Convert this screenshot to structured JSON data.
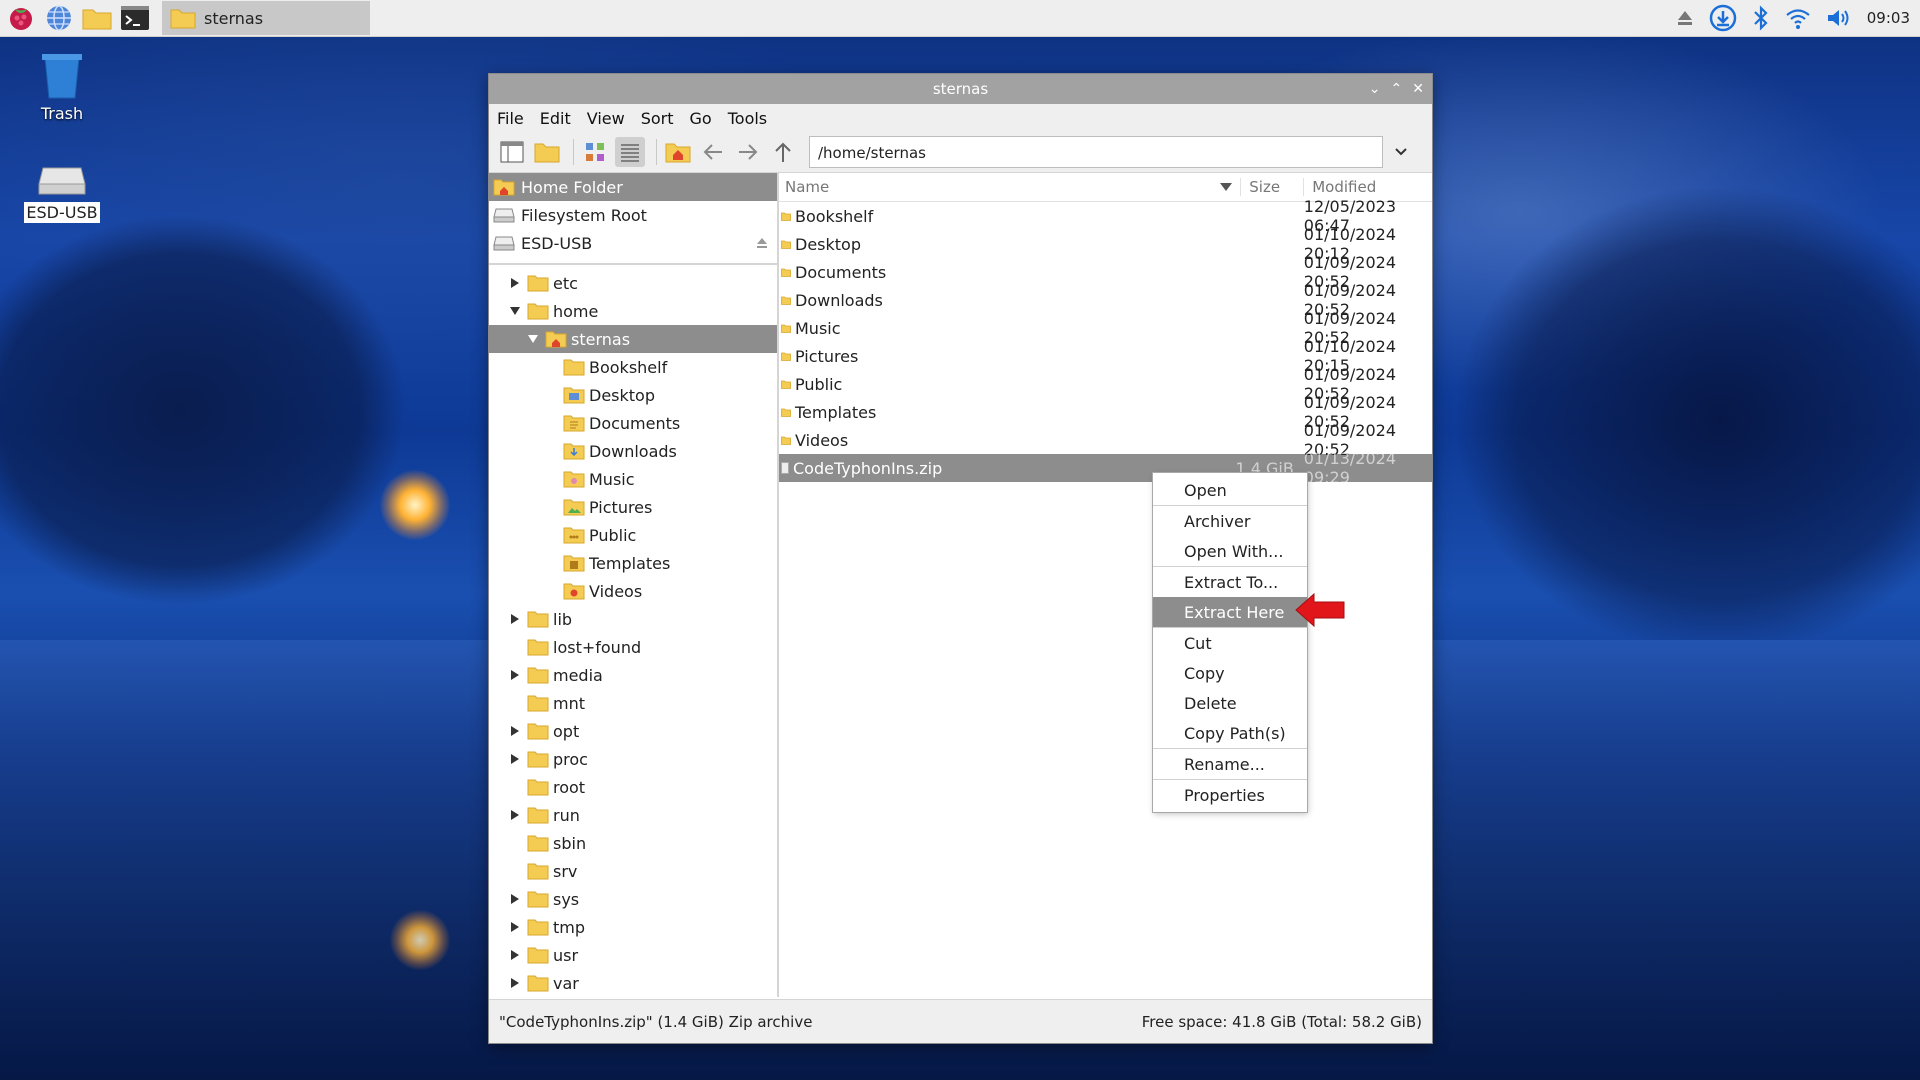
{
  "taskbar": {
    "task_label": "sternas",
    "clock": "09:03"
  },
  "desktop": {
    "icons": [
      {
        "label": "Trash"
      },
      {
        "label": "ESD-USB"
      }
    ]
  },
  "window": {
    "title": "sternas",
    "menu": [
      "File",
      "Edit",
      "View",
      "Sort",
      "Go",
      "Tools"
    ],
    "path": "/home/sternas"
  },
  "places": [
    {
      "label": "Home Folder",
      "icon": "home-icon",
      "selected": true
    },
    {
      "label": "Filesystem Root",
      "icon": "drive-icon"
    },
    {
      "label": "ESD-USB",
      "icon": "drive-icon",
      "eject": true
    }
  ],
  "tree": [
    {
      "label": "etc",
      "depth": 0,
      "exp": "collapsed"
    },
    {
      "label": "home",
      "depth": 0,
      "exp": "expanded"
    },
    {
      "label": "sternas",
      "depth": 1,
      "exp": "expanded",
      "home": true,
      "selected": true
    },
    {
      "label": "Bookshelf",
      "depth": 2
    },
    {
      "label": "Desktop",
      "depth": 2
    },
    {
      "label": "Documents",
      "depth": 2
    },
    {
      "label": "Downloads",
      "depth": 2
    },
    {
      "label": "Music",
      "depth": 2
    },
    {
      "label": "Pictures",
      "depth": 2
    },
    {
      "label": "Public",
      "depth": 2
    },
    {
      "label": "Templates",
      "depth": 2
    },
    {
      "label": "Videos",
      "depth": 2
    },
    {
      "label": "lib",
      "depth": 0,
      "exp": "collapsed"
    },
    {
      "label": "lost+found",
      "depth": 0
    },
    {
      "label": "media",
      "depth": 0,
      "exp": "collapsed"
    },
    {
      "label": "mnt",
      "depth": 0
    },
    {
      "label": "opt",
      "depth": 0,
      "exp": "collapsed"
    },
    {
      "label": "proc",
      "depth": 0,
      "exp": "collapsed"
    },
    {
      "label": "root",
      "depth": 0
    },
    {
      "label": "run",
      "depth": 0,
      "exp": "collapsed"
    },
    {
      "label": "sbin",
      "depth": 0
    },
    {
      "label": "srv",
      "depth": 0
    },
    {
      "label": "sys",
      "depth": 0,
      "exp": "collapsed"
    },
    {
      "label": "tmp",
      "depth": 0,
      "exp": "collapsed"
    },
    {
      "label": "usr",
      "depth": 0,
      "exp": "collapsed"
    },
    {
      "label": "var",
      "depth": 0,
      "exp": "collapsed"
    }
  ],
  "columns": {
    "name": "Name",
    "size": "Size",
    "modified": "Modified"
  },
  "files": [
    {
      "name": "Bookshelf",
      "size": "",
      "modified": "12/05/2023 06:47"
    },
    {
      "name": "Desktop",
      "size": "",
      "modified": "01/10/2024 20:12"
    },
    {
      "name": "Documents",
      "size": "",
      "modified": "01/09/2024 20:52"
    },
    {
      "name": "Downloads",
      "size": "",
      "modified": "01/09/2024 20:52"
    },
    {
      "name": "Music",
      "size": "",
      "modified": "01/09/2024 20:52"
    },
    {
      "name": "Pictures",
      "size": "",
      "modified": "01/10/2024 20:15"
    },
    {
      "name": "Public",
      "size": "",
      "modified": "01/09/2024 20:52"
    },
    {
      "name": "Templates",
      "size": "",
      "modified": "01/09/2024 20:52"
    },
    {
      "name": "Videos",
      "size": "",
      "modified": "01/09/2024 20:52"
    },
    {
      "name": "CodeTyphonIns.zip",
      "size": "1.4 GiB",
      "modified": "01/13/2024 09:29",
      "selected": true,
      "file": true
    }
  ],
  "context_menu": [
    {
      "label": "Open"
    },
    {
      "sep": true
    },
    {
      "label": "Archiver"
    },
    {
      "label": "Open With..."
    },
    {
      "sep": true
    },
    {
      "label": "Extract To..."
    },
    {
      "label": "Extract Here",
      "highlight": true
    },
    {
      "sep": true
    },
    {
      "label": "Cut"
    },
    {
      "label": "Copy"
    },
    {
      "label": "Delete"
    },
    {
      "label": "Copy Path(s)"
    },
    {
      "sep": true
    },
    {
      "label": "Rename..."
    },
    {
      "sep": true
    },
    {
      "label": "Properties"
    }
  ],
  "status": {
    "left": "\"CodeTyphonIns.zip\" (1.4 GiB) Zip archive",
    "right": "Free space: 41.8 GiB (Total: 58.2 GiB)"
  },
  "colors": {
    "folder": "#f5cc53",
    "selection": "#8d8d8d",
    "arrow": "#e0161b",
    "accent_blue": "#1d6fd8"
  }
}
